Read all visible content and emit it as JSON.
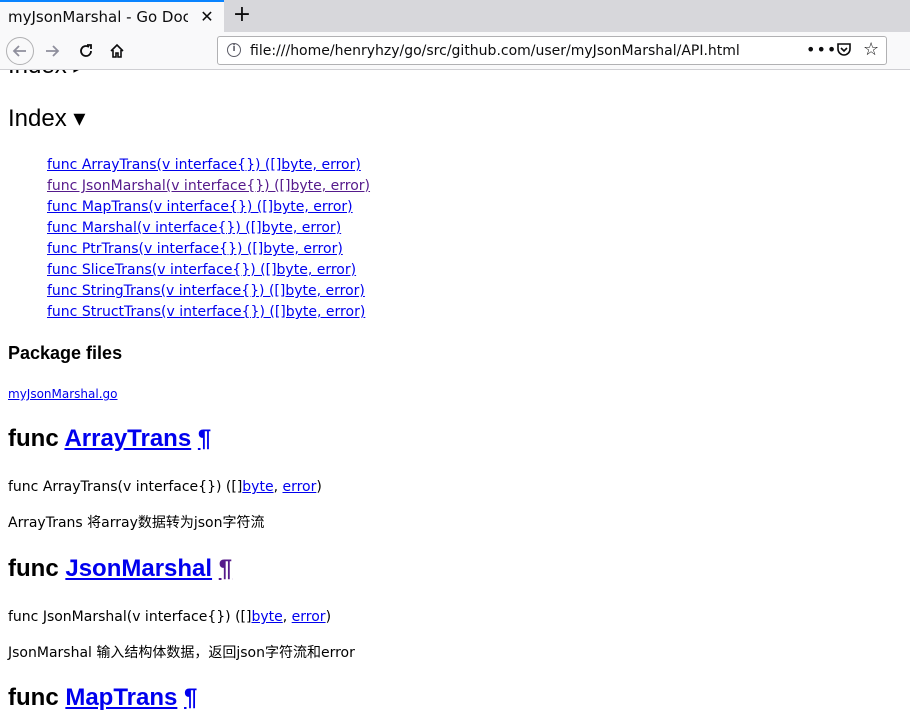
{
  "browser": {
    "tab_title": "myJsonMarshal - Go Docume",
    "tab_close": "✕",
    "new_tab": "+",
    "url": "file:///home/henryhzy/go/src/github.com/user/myJsonMarshal/API.html",
    "page_actions": "•••",
    "icons": [
      "back-arrow-icon",
      "forward-arrow-icon",
      "reload-icon",
      "home-icon",
      "info-icon",
      "pocket-icon",
      "star-icon"
    ]
  },
  "page": {
    "top_heading": "Index ▸",
    "index_heading": "Index ▾",
    "index_items": [
      "func ArrayTrans(v interface{}) ([]byte, error)",
      "func JsonMarshal(v interface{}) ([]byte, error)",
      "func MapTrans(v interface{}) ([]byte, error)",
      "func Marshal(v interface{}) ([]byte, error)",
      "func PtrTrans(v interface{}) ([]byte, error)",
      "func SliceTrans(v interface{}) ([]byte, error)",
      "func StringTrans(v interface{}) ([]byte, error)",
      "func StructTrans(v interface{}) ([]byte, error)"
    ],
    "package_files_heading": "Package files",
    "package_file": "myJsonMarshal.go",
    "funcs": [
      {
        "keyword": "func",
        "name": "ArrayTrans",
        "pilcrow": "¶",
        "sig_prefix": "func ArrayTrans(v interface{}) ([]",
        "sig_byte": "byte",
        "sig_sep": ", ",
        "sig_error": "error",
        "sig_suffix": ")",
        "desc": "ArrayTrans 将array数据转为json字符流"
      },
      {
        "keyword": "func",
        "name": "JsonMarshal",
        "pilcrow": "¶",
        "sig_prefix": "func JsonMarshal(v interface{}) ([]",
        "sig_byte": "byte",
        "sig_sep": ", ",
        "sig_error": "error",
        "sig_suffix": ")",
        "desc": "JsonMarshal 输入结构体数据，返回json字符流和error"
      },
      {
        "keyword": "func",
        "name": "MapTrans",
        "pilcrow": "¶"
      }
    ]
  }
}
